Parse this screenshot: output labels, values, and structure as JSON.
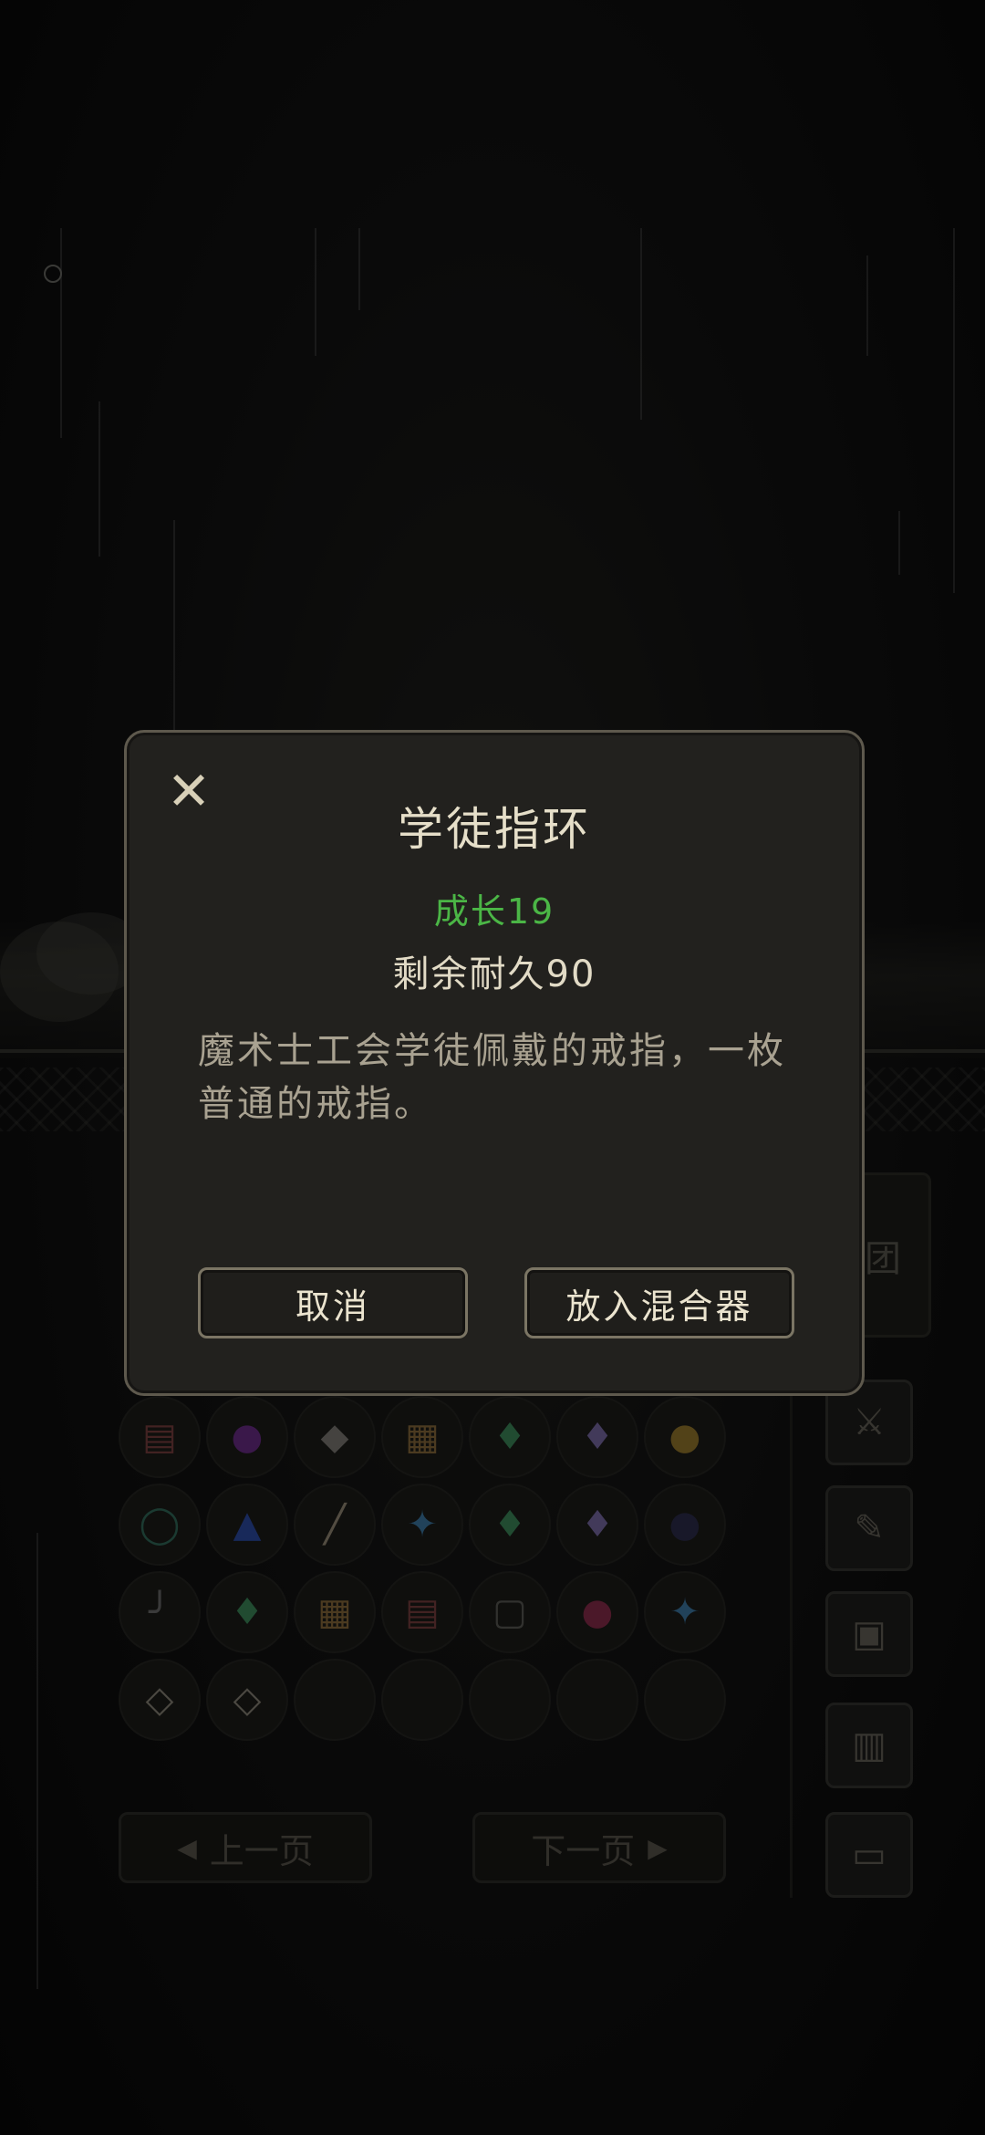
{
  "modal": {
    "title": "学徒指环",
    "growth": "成长19",
    "durability": "剩余耐久90",
    "description": "魔术士工会学徒佩戴的戒指，一枚普通的戒指。",
    "cancel_label": "取消",
    "add_to_mixer_label": "放入混合器",
    "close_icon": "✕"
  },
  "side_tab": {
    "label": "团"
  },
  "pager": {
    "prev_label": "上一页",
    "next_label": "下一页",
    "prev_icon": "◀",
    "next_icon": "▶"
  },
  "inventory": {
    "rows": [
      [
        "spellbook-icon",
        "purple-orbs-icon",
        "armor-icon",
        "magic-tome-icon",
        "green-crystal-icon",
        "violet-crystal-icon",
        "gold-coins-icon"
      ],
      [
        "green-ring-icon",
        "blue-pyramid-icon",
        "dagger-icon",
        "blue-crystal-cluster-icon",
        "green-crystal-icon",
        "violet-crystal-icon",
        "dark-orbs-icon"
      ],
      [
        "cane-icon",
        "green-crystal-icon",
        "magic-tome-icon",
        "spellbook-icon",
        "tombstone-icon",
        "red-berries-icon",
        "blue-crystal-cluster-icon"
      ],
      [
        "silver-ring-icon",
        "silver-ring-icon",
        "",
        "",
        "",
        "",
        ""
      ]
    ],
    "glyphs": {
      "spellbook-icon": "▤",
      "purple-orbs-icon": "●",
      "armor-icon": "◆",
      "magic-tome-icon": "▦",
      "green-crystal-icon": "♦",
      "violet-crystal-icon": "♦",
      "gold-coins-icon": "●",
      "green-ring-icon": "◯",
      "blue-pyramid-icon": "▲",
      "dagger-icon": "╱",
      "blue-crystal-cluster-icon": "✦",
      "dark-orbs-icon": "●",
      "cane-icon": "╯",
      "tombstone-icon": "▢",
      "red-berries-icon": "●",
      "silver-ring-icon": "◇"
    },
    "glyph_colors": {
      "spellbook-icon": "#7a3d3d",
      "purple-orbs-icon": "#6a2a8a",
      "armor-icon": "#7f7d77",
      "magic-tome-icon": "#8a6a3a",
      "green-crystal-icon": "#3a8a5a",
      "violet-crystal-icon": "#7a6aa8",
      "gold-coins-icon": "#9a7a2a",
      "green-ring-icon": "#2f6a5a",
      "blue-pyramid-icon": "#2a4aa8",
      "dagger-icon": "#9a8e7a",
      "blue-crystal-cluster-icon": "#3a7aa8",
      "dark-orbs-icon": "#2a2a4a",
      "cane-icon": "#6a6a6a",
      "tombstone-icon": "#5a5a55",
      "red-berries-icon": "#8a2a4a",
      "silver-ring-icon": "#8a857a"
    }
  },
  "side_buttons": [
    {
      "icon": "crossed-swords-icon",
      "glyph": "⚔"
    },
    {
      "icon": "quest-scroll-icon",
      "glyph": "✎"
    },
    {
      "icon": "map-icon",
      "glyph": "▣"
    },
    {
      "icon": "documents-icon",
      "glyph": "▥"
    },
    {
      "icon": "computer-icon",
      "glyph": "▭"
    }
  ],
  "colors": {
    "growth": "#4bb646",
    "title": "#e6dfc9",
    "modal_bg": "#22211e",
    "modal_border": "#5e594d"
  }
}
